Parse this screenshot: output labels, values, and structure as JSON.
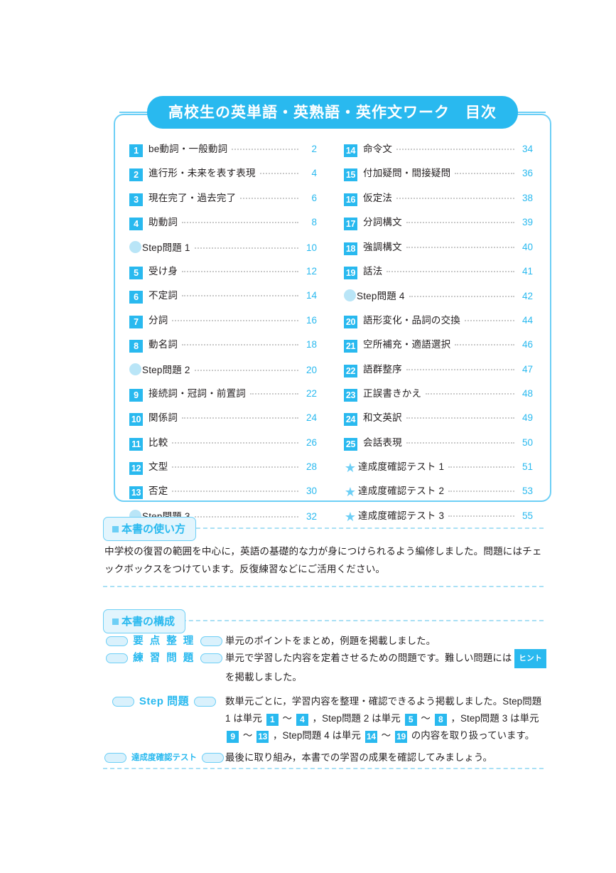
{
  "toc": {
    "title": "高校生の英単語・英熟語・英作文ワーク　目次",
    "left_items": [
      {
        "marker": "num",
        "num": "1",
        "label": "be動詞・一般動詞",
        "page": "2"
      },
      {
        "marker": "num",
        "num": "2",
        "label": "進行形・未来を表す表現",
        "page": "4"
      },
      {
        "marker": "num",
        "num": "3",
        "label": "現在完了・過去完了",
        "page": "6"
      },
      {
        "marker": "num",
        "num": "4",
        "label": "助動詞",
        "page": "8"
      },
      {
        "marker": "circle",
        "num": "",
        "label": "Step問題 1",
        "page": "10"
      },
      {
        "marker": "num",
        "num": "5",
        "label": "受け身",
        "page": "12"
      },
      {
        "marker": "num",
        "num": "6",
        "label": "不定詞",
        "page": "14"
      },
      {
        "marker": "num",
        "num": "7",
        "label": "分詞",
        "page": "16"
      },
      {
        "marker": "num",
        "num": "8",
        "label": "動名詞",
        "page": "18"
      },
      {
        "marker": "circle",
        "num": "",
        "label": "Step問題 2",
        "page": "20"
      },
      {
        "marker": "num",
        "num": "9",
        "label": "接続詞・冠詞・前置詞",
        "page": "22"
      },
      {
        "marker": "num",
        "num": "10",
        "label": "関係詞",
        "page": "24"
      },
      {
        "marker": "num",
        "num": "11",
        "label": "比較",
        "page": "26"
      },
      {
        "marker": "num",
        "num": "12",
        "label": "文型",
        "page": "28"
      },
      {
        "marker": "num",
        "num": "13",
        "label": "否定",
        "page": "30"
      },
      {
        "marker": "circle",
        "num": "",
        "label": "Step問題 3",
        "page": "32"
      }
    ],
    "right_items": [
      {
        "marker": "num",
        "num": "14",
        "label": "命令文",
        "page": "34"
      },
      {
        "marker": "num",
        "num": "15",
        "label": "付加疑問・間接疑問",
        "page": "36"
      },
      {
        "marker": "num",
        "num": "16",
        "label": "仮定法",
        "page": "38"
      },
      {
        "marker": "num",
        "num": "17",
        "label": "分詞構文",
        "page": "39"
      },
      {
        "marker": "num",
        "num": "18",
        "label": "強調構文",
        "page": "40"
      },
      {
        "marker": "num",
        "num": "19",
        "label": "話法",
        "page": "41"
      },
      {
        "marker": "circle",
        "num": "",
        "label": "Step問題 4",
        "page": "42"
      },
      {
        "marker": "num",
        "num": "20",
        "label": "語形変化・品詞の交換",
        "page": "44"
      },
      {
        "marker": "num",
        "num": "21",
        "label": "空所補充・適語選択",
        "page": "46"
      },
      {
        "marker": "num",
        "num": "22",
        "label": "語群整序",
        "page": "47"
      },
      {
        "marker": "num",
        "num": "23",
        "label": "正誤書きかえ",
        "page": "48"
      },
      {
        "marker": "num",
        "num": "24",
        "label": "和文英訳",
        "page": "49"
      },
      {
        "marker": "num",
        "num": "25",
        "label": "会話表現",
        "page": "50"
      },
      {
        "marker": "star",
        "num": "",
        "label": "達成度確認テスト 1",
        "page": "51"
      },
      {
        "marker": "star",
        "num": "",
        "label": "達成度確認テスト 2",
        "page": "53"
      },
      {
        "marker": "star",
        "num": "",
        "label": "達成度確認テスト 3",
        "page": "55"
      }
    ]
  },
  "usage": {
    "heading": "本書の使い方",
    "body": "中学校の復習の範囲を中心に，英語の基礎的な力が身につけられるよう編修しました。問題にはチェックボックスをつけています。反復練習などにご活用ください。"
  },
  "structure": {
    "heading": "本書の構成",
    "rows": [
      {
        "tag": "要 点 整 理",
        "desc": "単元のポイントをまとめ，例題を掲載しました。"
      },
      {
        "tag": "練 習 問 題",
        "desc_a": "単元で学習した内容を定着させるための問題です。難しい問題には ",
        "hint": "ヒント",
        "desc_b": " を掲載しました。"
      },
      {
        "tag": "Step 問題",
        "d1": "数単元ごとに，学習内容を整理・確認できるよう掲載しました。Step問題 1 は単元 ",
        "n1": "1",
        "d2": " ～ ",
        "n2": "4",
        "d3": " ，Step問題 2 は単元 ",
        "n3": "5",
        "d4": " ～ ",
        "n4": "8",
        "d5": " ，Step問題 3 は単元 ",
        "n5": "9",
        "d6": " ～ ",
        "n6": "13",
        "d7": " ，Step問題 4 は単元 ",
        "n7": "14",
        "d8": " ～ ",
        "n8": "19",
        "d9": " の内容を取り扱っています。"
      },
      {
        "tag": "達成度確認テスト",
        "desc": "最後に取り組み，本書での学習の成果を確認してみましょう。"
      }
    ]
  },
  "colors": {
    "accent": "#29b9ef",
    "light_accent": "#6dcff6",
    "pale_accent": "#daf1fc",
    "circle": "#b9e5f7",
    "dot_leader": "#c9c9c9",
    "text": "#231f20"
  }
}
